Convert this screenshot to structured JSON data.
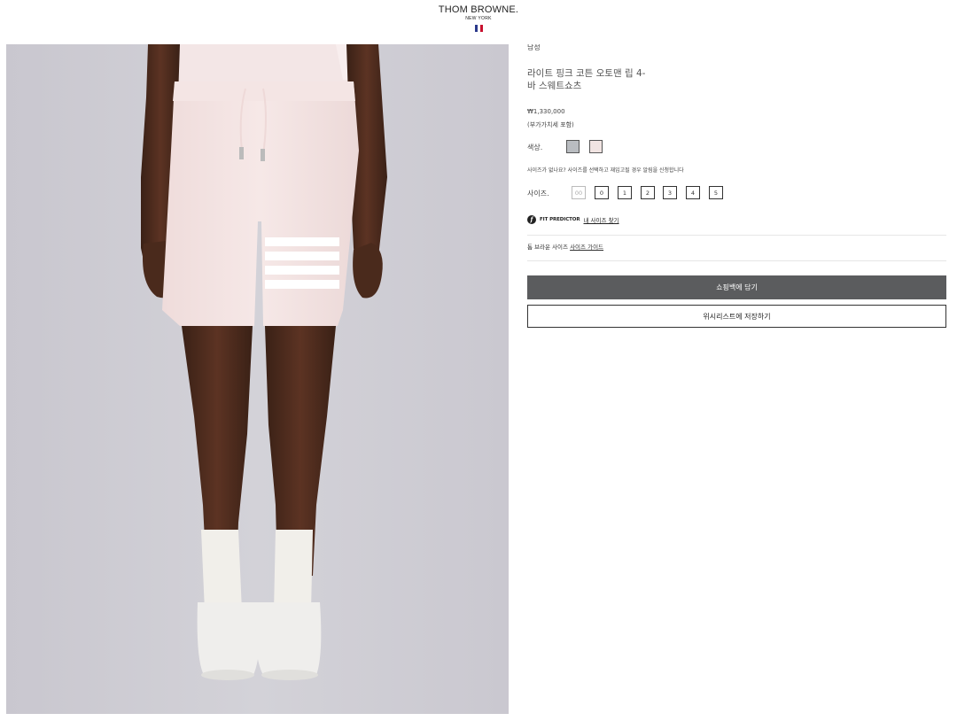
{
  "header": {
    "brand": "THOM BROWNE.",
    "brand_sub": "NEW YORK",
    "flag_colors": [
      "#2b3a8c",
      "#ffffff",
      "#c8102e"
    ]
  },
  "product": {
    "image_alt": "라이트 핑크 코튼 오토맨 립 4-바 스웨트쇼츠",
    "image_icon": "product-photo-shorts",
    "gender": "남성",
    "title_line1": "라이트 핑크 코튼 오토맨 립 4-",
    "title_line2": "바 스웨트쇼츠",
    "price": "₩1,330,000",
    "tax_note": "(부가가치세 포함)",
    "color_label": "색상.",
    "colors": [
      {
        "name": "light-grey",
        "hex": "#b9bcc0"
      },
      {
        "name": "light-pink",
        "hex": "#f1e4e2"
      }
    ],
    "size_notice": "사이즈가 없나요? 사이즈를 선택하고 재입고될 경우 알림을 신청합니다",
    "size_label": "사이즈.",
    "sizes": [
      {
        "label": "00",
        "available": false
      },
      {
        "label": "0",
        "available": true
      },
      {
        "label": "1",
        "available": true
      },
      {
        "label": "2",
        "available": true
      },
      {
        "label": "3",
        "available": true
      },
      {
        "label": "4",
        "available": true
      },
      {
        "label": "5",
        "available": true
      }
    ],
    "fit_brand": "FIT PREDICTOR",
    "fit_link": "내 사이즈 찾기",
    "guide_prefix": "톰 브라운 사이즈",
    "guide_link": "사이즈 가이드",
    "add_to_bag": "쇼핑백에 담기",
    "add_to_wishlist": "위시리스트에 저장하기"
  },
  "colors": {
    "image_bg": "#cfcdd4",
    "button_dark": "#5b5c5e"
  }
}
